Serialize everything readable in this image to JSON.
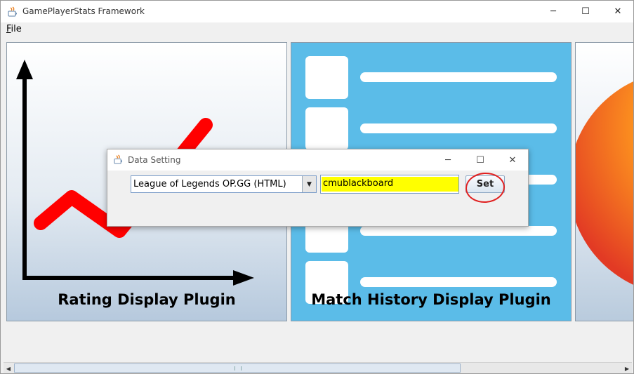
{
  "window": {
    "title": "GamePlayerStats Framework",
    "controls": {
      "minimize": "─",
      "maximize": "☐",
      "close": "✕"
    }
  },
  "menubar": {
    "file_mnemonic": "F",
    "file_rest": "ile"
  },
  "plugins": [
    {
      "label": "Rating Display Plugin"
    },
    {
      "label": "Match History Display Plugin"
    },
    {
      "label": ""
    }
  ],
  "dialog": {
    "title": "Data Setting",
    "controls": {
      "minimize": "─",
      "maximize": "☐",
      "close": "✕"
    },
    "data_source_selected": "League of Legends OP.GG (HTML)",
    "player_name_value": "cmublackboard",
    "set_label": "Set"
  },
  "scrollbar": {
    "left_arrow": "◀",
    "right_arrow": "▶"
  },
  "colors": {
    "match_panel_bg": "#5bbce8",
    "chart_line": "#ff0000",
    "highlight": "#ffff00",
    "annotation_circle": "#e02020"
  }
}
